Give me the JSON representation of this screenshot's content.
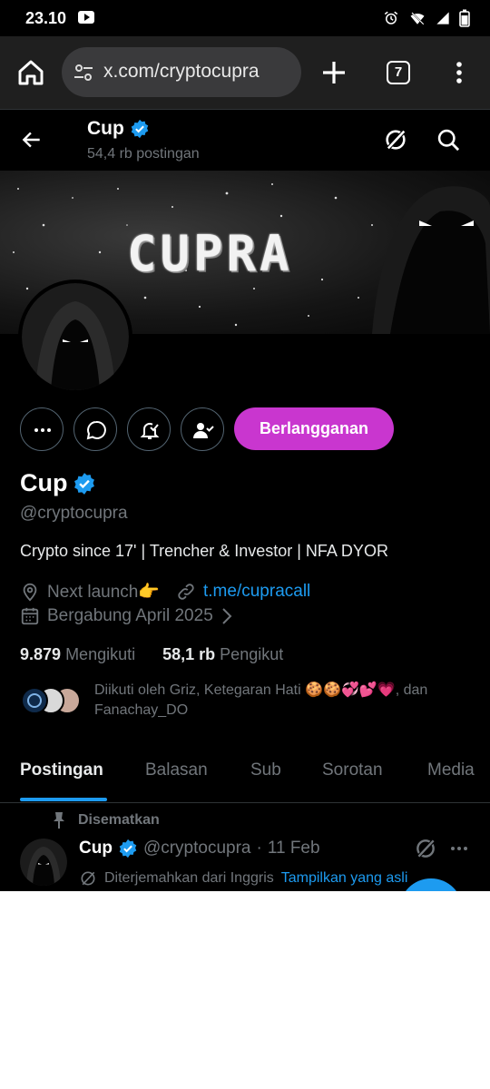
{
  "status_bar": {
    "time": "23.10"
  },
  "browser": {
    "url": "x.com/cryptocupra",
    "tab_count": "7"
  },
  "header": {
    "name": "Cup",
    "post_count": "54,4 rb postingan"
  },
  "banner": {
    "title": "CUPRA"
  },
  "actions": {
    "subscribe_label": "Berlangganan"
  },
  "profile": {
    "name": "Cup",
    "handle": "@cryptocupra",
    "bio": "Crypto since 17' | Trencher & Investor | NFA DYOR",
    "location": "Next launch👉",
    "link": "t.me/cupracall",
    "joined": "Bergabung April 2025",
    "following_count": "9.879",
    "following_label": "Mengikuti",
    "followers_count": "58,1 rb",
    "followers_label": "Pengikut",
    "followed_by": "Diikuti oleh Griz, Ketegaran Hati 🍪🍪💞💕💗, dan Fanachay_DO"
  },
  "tabs": [
    {
      "label": "Postingan"
    },
    {
      "label": "Balasan"
    },
    {
      "label": "Sub"
    },
    {
      "label": "Sorotan"
    },
    {
      "label": "Media"
    }
  ],
  "pinned_tweet": {
    "pinned_label": "Disematkan",
    "name": "Cup",
    "handle": "@cryptocupra",
    "separator": "·",
    "date": "11 Feb",
    "translated_label": "Diterjemahkan dari Inggris",
    "show_original": "Tampilkan yang asli"
  },
  "colors": {
    "accent": "#1d9bf0",
    "subscribe": "#c936cf",
    "background": "#000000",
    "muted": "#71767b"
  }
}
